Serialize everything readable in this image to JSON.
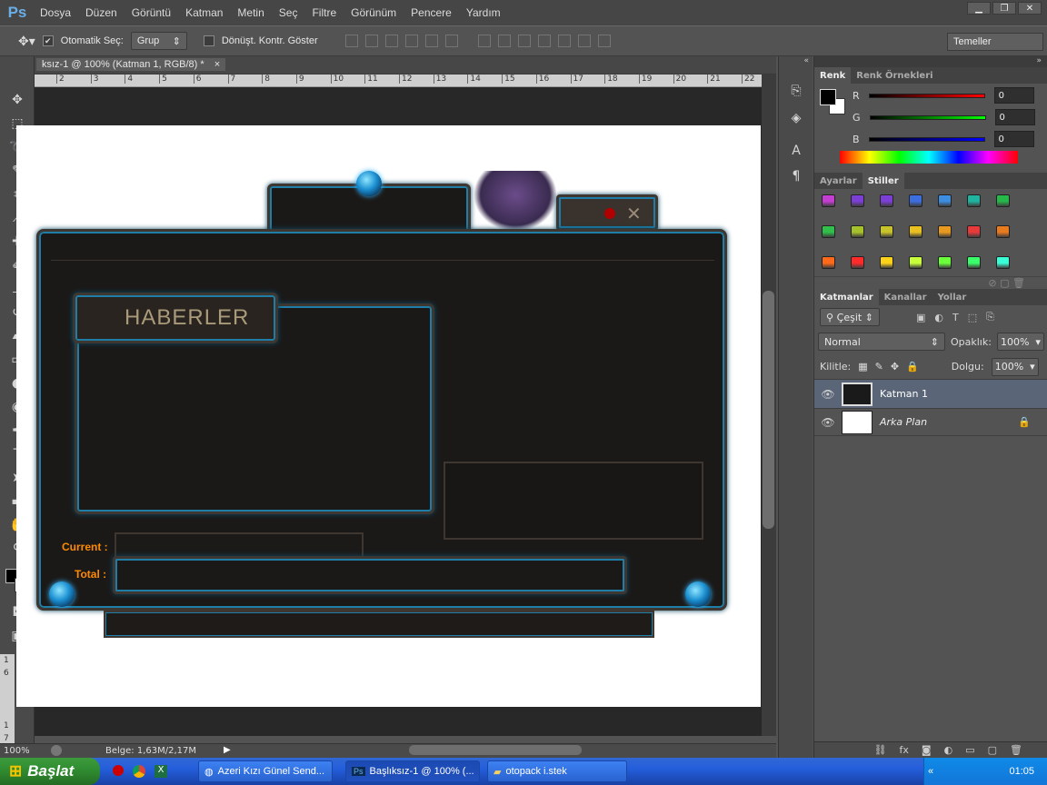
{
  "app": {
    "logo": "Ps"
  },
  "menu": [
    "Dosya",
    "Düzen",
    "Görüntü",
    "Katman",
    "Metin",
    "Seç",
    "Filtre",
    "Görünüm",
    "Pencere",
    "Yardım"
  ],
  "options": {
    "auto_select_label": "Otomatik Seç:",
    "auto_select_value": "Grup",
    "transform_label": "Dönüşt. Kontr. Göster"
  },
  "workspace": "Temeller",
  "document": {
    "tab_title": "ksız-1 @ 100% (Katman 1, RGB/8) *",
    "close": "×",
    "ruler_ticks": [
      "2",
      "3",
      "4",
      "5",
      "6",
      "7",
      "8",
      "9",
      "10",
      "11",
      "12",
      "13",
      "14",
      "15",
      "16",
      "17",
      "18",
      "19",
      "20",
      "21",
      "22"
    ],
    "vruler_ticks": [
      "1",
      "6",
      "1",
      "7"
    ]
  },
  "artwork": {
    "news_title": "HABERLER",
    "current_label": "Current :",
    "total_label": "Total :"
  },
  "status": {
    "zoom": "100%",
    "doc_info": "Belge: 1,63M/2,17M"
  },
  "color_panel": {
    "tabs": [
      "Renk",
      "Renk Örnekleri"
    ],
    "channels": [
      {
        "name": "R",
        "value": "0"
      },
      {
        "name": "G",
        "value": "0"
      },
      {
        "name": "B",
        "value": "0"
      }
    ]
  },
  "styles_panel": {
    "tabs": [
      "Ayarlar",
      "Stiller"
    ],
    "swatch_colors": [
      "#c43ed1",
      "#7b3fd6",
      "#7b3fd6",
      "#3d6ee0",
      "#3d8ee0",
      "#1fb3a0",
      "#27b84a",
      "#2fbf4a",
      "#a6c22b",
      "#c8c22b",
      "#e8c020",
      "#e89a20",
      "#e83a3a",
      "#e87a20",
      "#ff6a1a",
      "#ff2a2a",
      "#ffd21a",
      "#c8ff3a",
      "#6aff3a",
      "#3aff6a",
      "#3affd6"
    ]
  },
  "layers_panel": {
    "tabs": [
      "Katmanlar",
      "Kanallar",
      "Yollar"
    ],
    "filter_label": "Çeşit",
    "blend_mode": "Normal",
    "opacity_label": "Opaklık:",
    "opacity_value": "100%",
    "lock_label": "Kilitle:",
    "fill_label": "Dolgu:",
    "fill_value": "100%",
    "layers": [
      {
        "name": "Katman 1",
        "selected": true
      },
      {
        "name": "Arka Plan",
        "locked": true
      }
    ]
  },
  "taskbar": {
    "start": "Başlat",
    "tasks": [
      "Azeri Kızı Günel Send...",
      "Başlıksız-1 @ 100% (...",
      "otopack i.stek"
    ],
    "clock": "01:05"
  }
}
